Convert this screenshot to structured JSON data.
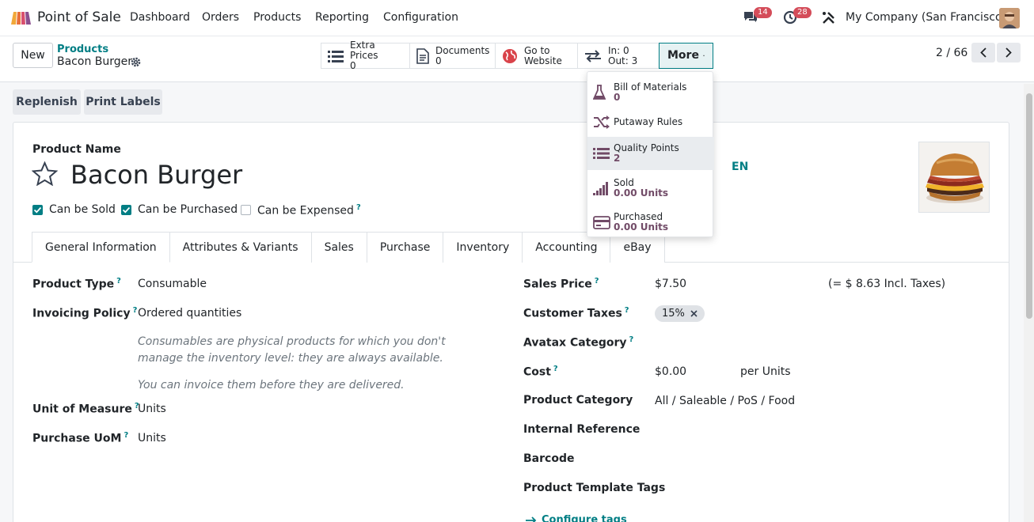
{
  "navbar": {
    "app_name": "Point of Sale",
    "menu": [
      "Dashboard",
      "Orders",
      "Products",
      "Reporting",
      "Configuration"
    ],
    "messages_count": "14",
    "activities_count": "28",
    "company": "My Company (San Francisco)"
  },
  "control_panel": {
    "new_label": "New",
    "breadcrumb_parent": "Products",
    "breadcrumb_current": "Bacon Burger",
    "smart_buttons": {
      "extra_prices_label": "Extra Prices",
      "extra_prices_count": "0",
      "documents_label": "Documents",
      "documents_count": "0",
      "go_to_label": "Go to",
      "website_label": "Website",
      "in_label": "In: 0",
      "out_label": "Out: 3",
      "more_label": "More"
    },
    "pager": "2 / 66"
  },
  "more_menu": {
    "items": [
      {
        "label": "Bill of Materials",
        "value": "0"
      },
      {
        "label": "Putaway Rules",
        "value": ""
      },
      {
        "label": "Quality Points",
        "value": "2"
      },
      {
        "label": "Sold",
        "value": "0.00 Units"
      },
      {
        "label": "Purchased",
        "value": "0.00 Units"
      }
    ]
  },
  "actions": {
    "replenish": "Replenish",
    "print_labels": "Print Labels"
  },
  "form": {
    "product_name_label": "Product Name",
    "product_name": "Bacon Burger",
    "lang": "EN",
    "can_be_sold": "Can be Sold",
    "can_be_purchased": "Can be Purchased",
    "can_be_expensed": "Can be Expensed",
    "tabs": [
      "General Information",
      "Attributes & Variants",
      "Sales",
      "Purchase",
      "Inventory",
      "Accounting",
      "eBay"
    ],
    "product_type_label": "Product Type",
    "product_type": "Consumable",
    "invoicing_policy_label": "Invoicing Policy",
    "invoicing_policy": "Ordered quantities",
    "consumable_note": "Consumables are physical products for which you don't manage the inventory level: they are always available.",
    "invoice_note": "You can invoice them before they are delivered.",
    "uom_label": "Unit of Measure",
    "uom": "Units",
    "purchase_uom_label": "Purchase UoM",
    "purchase_uom": "Units",
    "sales_price_label": "Sales Price",
    "sales_price": "$7.50",
    "incl_taxes": "(= $ 8.63 Incl. Taxes)",
    "customer_taxes_label": "Customer Taxes",
    "customer_tax": "15%",
    "avatax_label": "Avatax Category",
    "cost_label": "Cost",
    "cost": "$0.00",
    "per_units": "per Units",
    "product_category_label": "Product Category",
    "product_category": "All / Saleable / PoS / Food",
    "internal_ref_label": "Internal Reference",
    "barcode_label": "Barcode",
    "template_tags_label": "Product Template Tags",
    "configure_tags": "Configure tags"
  },
  "colors": {
    "primary": "#714b67",
    "accent": "#017e84",
    "badge": "#d44c59"
  }
}
